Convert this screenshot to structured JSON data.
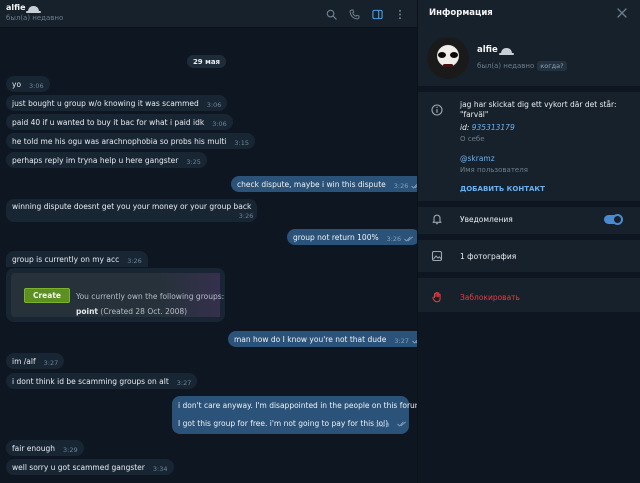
{
  "header": {
    "name": "alfie",
    "status": "был(а) недавно"
  },
  "chat": {
    "date": "29 мая",
    "messages": [
      {
        "dir": "in",
        "text": "yo",
        "time": "3:06"
      },
      {
        "dir": "in",
        "text": "just bought u group w/o knowing it was scammed",
        "time": "3:06"
      },
      {
        "dir": "in",
        "text": "paid 40 if u wanted to buy it bac for what i paid idk",
        "time": "3:06"
      },
      {
        "dir": "in",
        "text": "he told me his ogu was arachnophobia so probs his multi",
        "time": "3:15"
      },
      {
        "dir": "in",
        "text": "perhaps reply im tryna help u here gangster",
        "time": "3:25"
      },
      {
        "dir": "out",
        "text": "check dispute, maybe i win this dispute",
        "time": "3:26"
      },
      {
        "dir": "in",
        "text": "winning dispute doesnt get you your money or your group back",
        "time": "3:26"
      },
      {
        "dir": "out",
        "text": "group not return 100%",
        "time": "3:26"
      },
      {
        "dir": "in",
        "text": "group is currently on my acc",
        "time": "3:26"
      },
      {
        "dir": "out",
        "text": "man how do I know you're not that dude",
        "time": "3:27"
      },
      {
        "dir": "in",
        "text": "im /alf",
        "time": "3:27"
      },
      {
        "dir": "in",
        "text": "i dont think id be scamming groups on alt",
        "time": "3:27"
      },
      {
        "dir": "in",
        "text": "fair enough",
        "time": "3:29"
      },
      {
        "dir": "in",
        "text": "well sorry u got scammed gangster",
        "time": "3:34"
      }
    ],
    "image_card": {
      "button": "Create",
      "line1": "You currently own the following groups:",
      "group_name": "point",
      "group_meta": "(Created 28 Oct. 2008)"
    },
    "multiline": {
      "line1": "i don't care anyway. I'm disappointed in the people on this forum.",
      "line2": "I got this group for free. i'm not going to pay for this lol)",
      "time": "3:29"
    }
  },
  "info": {
    "title": "Информация",
    "name": "alfie",
    "status": "был(а) недавно",
    "when_badge": "когда?",
    "about_text": "jag har skickat dig ett vykort där det står: \"farväl\"",
    "id_label": "id:",
    "id_value": "935313179",
    "about_label": "О себе",
    "username": "@skramz",
    "username_label": "Имя пользователя",
    "add_contact": "ДОБАВИТЬ КОНТАКТ",
    "notifications": "Уведомления",
    "notifications_on": true,
    "photos": "1 фотография",
    "block": "Заблокировать"
  },
  "colors": {
    "chat_bg": "#0e1621",
    "panel_bg": "#17212b",
    "incoming_bubble": "#182533",
    "outgoing_bubble": "#2b5278",
    "accent": "#6ab2f2",
    "danger": "#ec3942",
    "create_button": "#5e8f22"
  }
}
